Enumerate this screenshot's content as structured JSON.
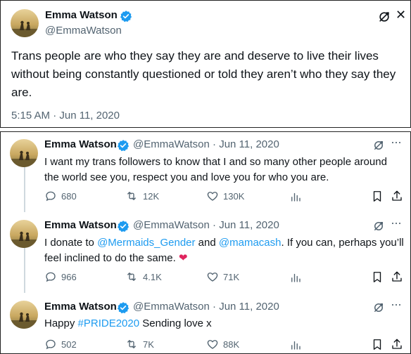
{
  "colors": {
    "text": "#0f1419",
    "muted": "#536471",
    "link": "#1d9bf0",
    "verified": "#1d9bf0",
    "heart": "#e0245e"
  },
  "main_tweet": {
    "author": {
      "name": "Emma Watson",
      "handle": "@EmmaWatson"
    },
    "text": "Trans people are who they say they are and deserve to live their lives without being constantly questioned or told they aren’t who they say they are.",
    "timestamp": "5:15 AM · Jun 11, 2020"
  },
  "thread": [
    {
      "name": "Emma Watson",
      "handle": "@EmmaWatson",
      "date": "· Jun 11, 2020",
      "text": "I want my trans followers to know that I and so many other people around the world see you, respect you and love you for who you are.",
      "replies": "680",
      "retweets": "12K",
      "likes": "130K"
    },
    {
      "name": "Emma Watson",
      "handle": "@EmmaWatson",
      "date": "· Jun 11, 2020",
      "text_a": "I donate to ",
      "mention1": "@Mermaids_Gender",
      "text_b": " and ",
      "mention2": "@mamacash",
      "text_c": ". If you can, perhaps you’ll feel inclined to do the same. ",
      "emoji": "❤",
      "replies": "966",
      "retweets": "4.1K",
      "likes": "71K"
    },
    {
      "name": "Emma Watson",
      "handle": "@EmmaWatson",
      "date": "· Jun 11, 2020",
      "text_a": "Happy ",
      "hashtag": "#PRIDE2020",
      "text_b": " Sending love x",
      "replies": "502",
      "retweets": "7K",
      "likes": "88K"
    }
  ]
}
